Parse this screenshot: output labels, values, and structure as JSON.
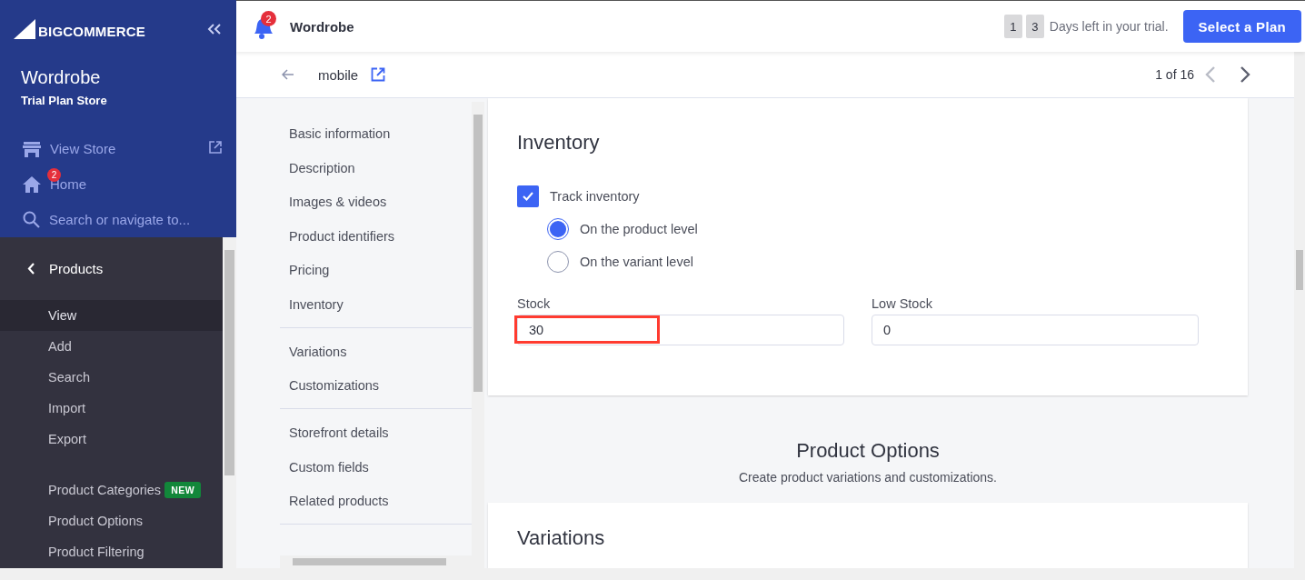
{
  "sidebar": {
    "logo": "BIGCOMMERCE",
    "store_name": "Wordrobe",
    "store_plan": "Trial Plan Store",
    "links": [
      {
        "kind": "store",
        "label": "View Store"
      },
      {
        "kind": "home",
        "label": "Home",
        "badge": "2"
      },
      {
        "kind": "search",
        "label": "Search or navigate to..."
      }
    ],
    "section": "Products",
    "item_groups": [
      [
        {
          "label": "View",
          "selected": true
        },
        {
          "label": "Add",
          "selected": false
        },
        {
          "label": "Search",
          "selected": false
        },
        {
          "label": "Import",
          "selected": false
        },
        {
          "label": "Export",
          "selected": false
        }
      ],
      [
        {
          "label": "Product Categories",
          "selected": false,
          "badge": "NEW"
        },
        {
          "label": "Product Options",
          "selected": false
        },
        {
          "label": "Product Filtering",
          "selected": false
        }
      ]
    ]
  },
  "topbar": {
    "notifications": "2",
    "store": "Wordrobe",
    "trial_digits": [
      "1",
      "3"
    ],
    "trial_text": "Days left in your trial.",
    "plan_button": "Select a Plan"
  },
  "product_header": {
    "name": "mobile",
    "pager": "1 of 16"
  },
  "section_nav": [
    [
      "Basic information",
      "Description",
      "Images & videos",
      "Product identifiers",
      "Pricing",
      "Inventory"
    ],
    [
      "Variations",
      "Customizations"
    ],
    [
      "Storefront details",
      "Custom fields",
      "Related products"
    ]
  ],
  "inventory": {
    "title": "Inventory",
    "track": {
      "label": "Track inventory",
      "checked": true
    },
    "levels": [
      {
        "label": "On the product level",
        "selected": true
      },
      {
        "label": "On the variant level",
        "selected": false
      }
    ],
    "fields": [
      {
        "label": "Stock",
        "value": "30",
        "highlighted": true
      },
      {
        "label": "Low Stock",
        "value": "0",
        "highlighted": false
      }
    ]
  },
  "product_options": {
    "title": "Product Options",
    "subtitle": "Create product variations and customizations."
  },
  "variations": {
    "title": "Variations"
  }
}
